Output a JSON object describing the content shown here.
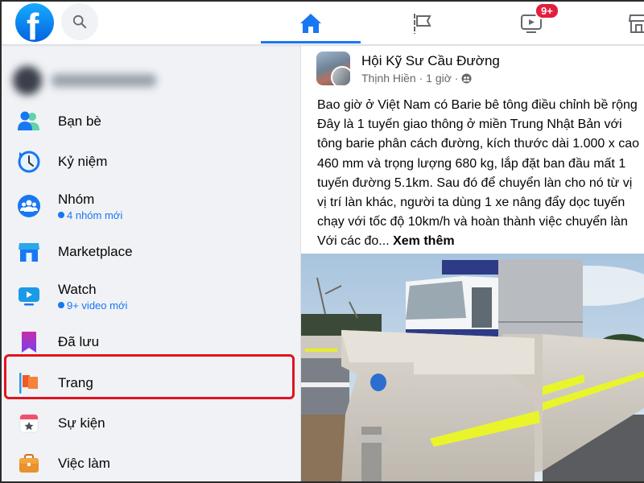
{
  "topbar": {
    "logo": "facebook-logo",
    "search_icon": "search-icon",
    "tabs": [
      {
        "name": "home",
        "icon": "home-icon",
        "active": true
      },
      {
        "name": "pages",
        "icon": "flag-icon",
        "active": false
      },
      {
        "name": "watch",
        "icon": "video-icon",
        "active": false,
        "badge": "9+"
      },
      {
        "name": "marketplace",
        "icon": "store-icon",
        "active": false
      }
    ],
    "accent_color": "#1877f2",
    "badge_color": "#e41e3f"
  },
  "sidebar": {
    "profile_name": "(blurred)",
    "items": [
      {
        "label": "Bạn bè",
        "icon": "friends-icon"
      },
      {
        "label": "Kỷ niệm",
        "icon": "memories-icon"
      },
      {
        "label": "Nhóm",
        "icon": "groups-icon",
        "sub": "4 nhóm mới"
      },
      {
        "label": "Marketplace",
        "icon": "marketplace-icon"
      },
      {
        "label": "Watch",
        "icon": "watch-icon",
        "sub": "9+ video mới"
      },
      {
        "label": "Đã lưu",
        "icon": "saved-icon"
      },
      {
        "label": "Trang",
        "icon": "pages-flag-icon",
        "highlighted": true
      },
      {
        "label": "Sự kiện",
        "icon": "events-icon"
      },
      {
        "label": "Việc làm",
        "icon": "jobs-icon"
      }
    ],
    "highlight_color": "#e0141e"
  },
  "post": {
    "page_name": "Hội Kỹ Sư Cầu Đường",
    "author": "Thịnh Hiền",
    "time": "1 giờ",
    "privacy_icon": "friends-privacy-icon",
    "lines": [
      "Bao giờ ở Việt Nam có Barie bê tông điều chỉnh bề rộng",
      "Đây là 1 tuyến giao thông ở miền Trung Nhật Bản với",
      "tông barie phân cách đường, kích thước dài 1.000 x cao",
      "460 mm và trọng lượng 680 kg, lắp đặt ban đầu mất 1",
      "tuyến đường 5.1km. Sau đó để chuyển làn cho nó từ vị",
      "vị trí làn khác, người ta dùng 1 xe nâng đẩy dọc tuyến",
      "chạy với tốc độ 10km/h và hoàn thành việc chuyển làn"
    ],
    "last_line": "Với các đo...",
    "see_more": "Xem thêm",
    "photo_alt": "Concrete road barriers with yellow reflective strips beside a white truck"
  }
}
